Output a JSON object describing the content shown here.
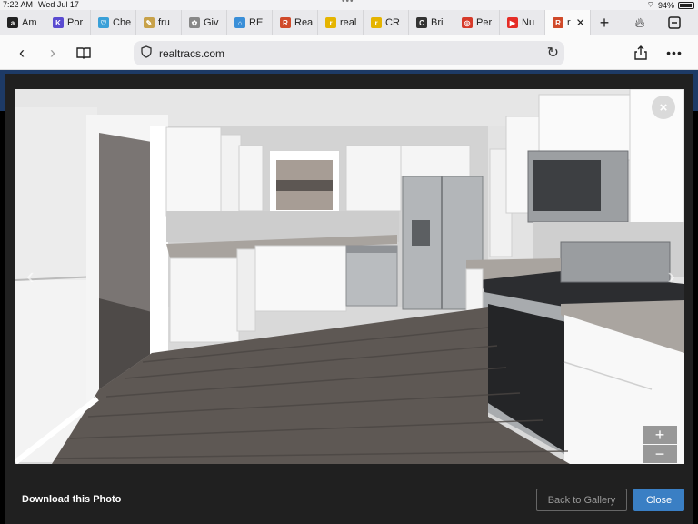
{
  "status_bar": {
    "time": "7:22 AM",
    "date": "Wed Jul 17",
    "battery": "94%"
  },
  "tabs": [
    {
      "label": "Am",
      "icon": "amazon-icon",
      "color": "#222222",
      "glyph": "a"
    },
    {
      "label": "Por",
      "icon": "k-logo-icon",
      "color": "#5a4bd1",
      "glyph": "K"
    },
    {
      "label": "Che",
      "icon": "heart-icon",
      "color": "#3aa0d8",
      "glyph": "♡"
    },
    {
      "label": "fru",
      "icon": "pin-icon",
      "color": "#c8a24a",
      "glyph": "✎"
    },
    {
      "label": "Giv",
      "icon": "flower-icon",
      "color": "#888888",
      "glyph": "✿"
    },
    {
      "label": "RE",
      "icon": "home-icon",
      "color": "#3a8fd8",
      "glyph": "⌂"
    },
    {
      "label": "Rea",
      "icon": "realtracs-icon",
      "color": "#d04a2a",
      "glyph": "R"
    },
    {
      "label": "real",
      "icon": "realtor-icon",
      "color": "#e5b400",
      "glyph": "r"
    },
    {
      "label": "CR",
      "icon": "realtor-icon",
      "color": "#e5b400",
      "glyph": "r"
    },
    {
      "label": "Bri",
      "icon": "c-logo-icon",
      "color": "#333333",
      "glyph": "C"
    },
    {
      "label": "Per",
      "icon": "lifebuoy-icon",
      "color": "#d63a2a",
      "glyph": "◎"
    },
    {
      "label": "Nu",
      "icon": "youtube-icon",
      "color": "#e52d27",
      "glyph": "▶"
    },
    {
      "label": "r",
      "icon": "realtracs-icon",
      "color": "#d04a2a",
      "glyph": "R",
      "active": true
    }
  ],
  "address_bar": {
    "url": "realtracs.com"
  },
  "modal": {
    "close_icon": "×",
    "zoom_in": "+",
    "zoom_out": "−",
    "prev_arrow": "‹",
    "next_arrow": "›",
    "download_label": "Download this Photo",
    "back_label": "Back to Gallery",
    "close_label": "Close",
    "accent_color": "#3a7fc4"
  }
}
